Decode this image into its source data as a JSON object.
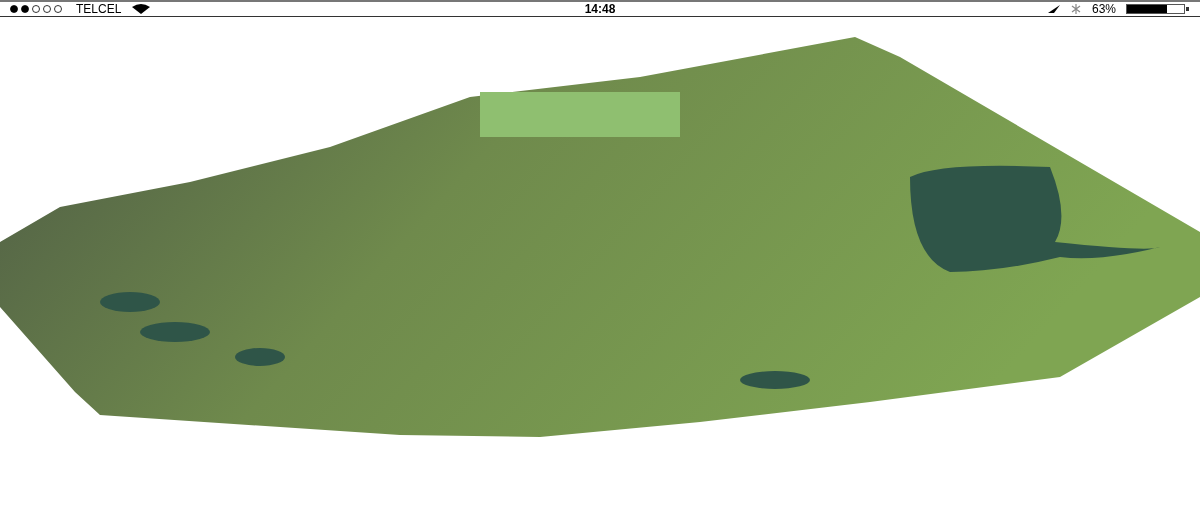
{
  "status_bar": {
    "carrier": "TELCEL",
    "time": "14:48",
    "battery": "63%"
  }
}
